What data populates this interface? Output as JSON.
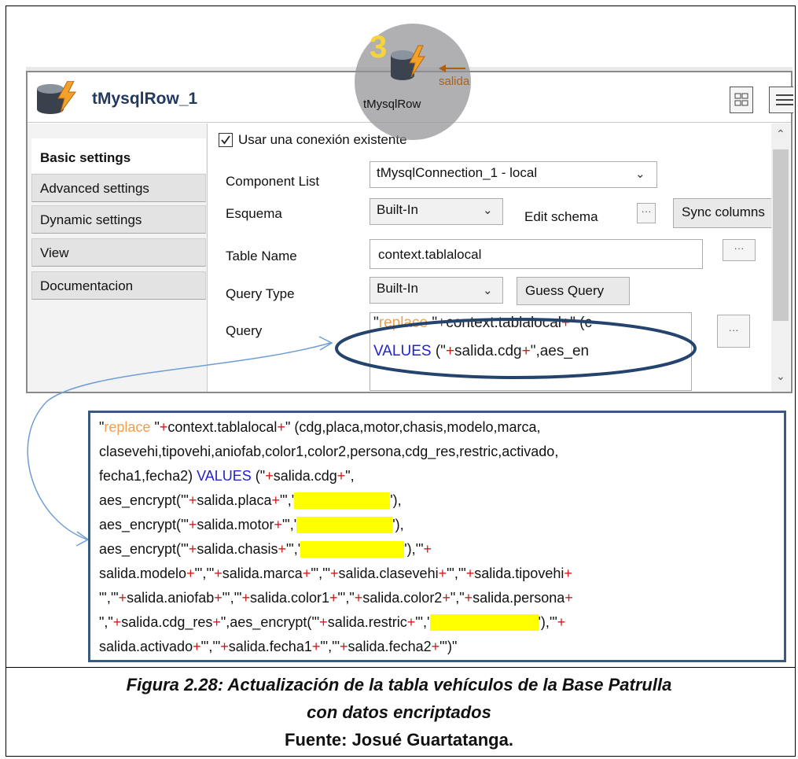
{
  "component": {
    "title": "tMysqlRow_1",
    "badge_number": "3",
    "badge_component_label": "tMysqlRow",
    "badge_link_label": "salida"
  },
  "tabs": [
    {
      "label": "Basic settings",
      "active": true
    },
    {
      "label": "Advanced settings",
      "active": false
    },
    {
      "label": "Dynamic settings",
      "active": false
    },
    {
      "label": "View",
      "active": false
    },
    {
      "label": "Documentacion",
      "active": false
    }
  ],
  "form": {
    "use_existing_connection": {
      "label": "Usar una conexión existente",
      "checked": true
    },
    "component_list": {
      "label": "Component List",
      "value": "tMysqlConnection_1 - local"
    },
    "schema": {
      "label": "Esquema",
      "value": "Built-In",
      "edit_label": "Edit schema",
      "sync_label": "Sync columns"
    },
    "table_name": {
      "label": "Table Name",
      "value": "context.tablalocal"
    },
    "query_type": {
      "label": "Query Type",
      "value": "Built-In",
      "guess_label": "Guess Query"
    },
    "query": {
      "label": "Query",
      "line1": {
        "q": "\"",
        "kw": "replace",
        "rest1": " \"",
        "plus1": "+",
        "ctx": "context.tablalocal",
        "plus2": "+",
        "tail": "\" (c"
      },
      "line2": {
        "kw": "VALUES",
        "rest1": " (\"",
        "plus1": "+",
        "var": "salida.cdg",
        "plus2": "+",
        "tail": "\",aes_en"
      }
    }
  },
  "code": {
    "lines": [
      "\"replace \"+context.tablalocal+\" (cdg,placa,motor,chasis,modelo,marca,",
      "clasevehi,tipovehi,aniofab,color1,color2,persona,cdg_res,restric,activado,",
      "fecha1,fecha2) VALUES (\"+salida.cdg+\",",
      "aes_encrypt('\"+salida.placa+\"','[redacted]'),",
      "aes_encrypt('\"+salida.motor+\"','[redacted]'),",
      "aes_encrypt('\"+salida.chasis+\"','[redacted]'),'\"+",
      "salida.modelo+\"','\"+salida.marca+\"','\"+salida.clasevehi+\"','\"+salida.tipovehi+",
      "\"','\"+salida.aniofab+\"','\"+salida.color1+\"',\"+salida.color2+\",\"+salida.persona+",
      "\",\"+salida.cdg_res+\",aes_encrypt('\"+salida.restric+\"','[redacted]'),'\"+",
      "salida.activado+\"','\"+salida.fecha1+\"','\"+salida.fecha2+\"')\""
    ]
  },
  "caption": {
    "line1": "Figura 2.28: Actualización de la tabla vehículos de la Base Patrulla",
    "line2": "con datos encriptados",
    "line3": "Fuente: Josué Guartatanga."
  },
  "colors": {
    "keyword_orange": "#f0a04b",
    "keyword_blue": "#2323c8",
    "operator_red": "#d01818",
    "highlight": "#ffff00",
    "frame_blue": "#3c5a7f",
    "title_blue": "#23395d"
  }
}
